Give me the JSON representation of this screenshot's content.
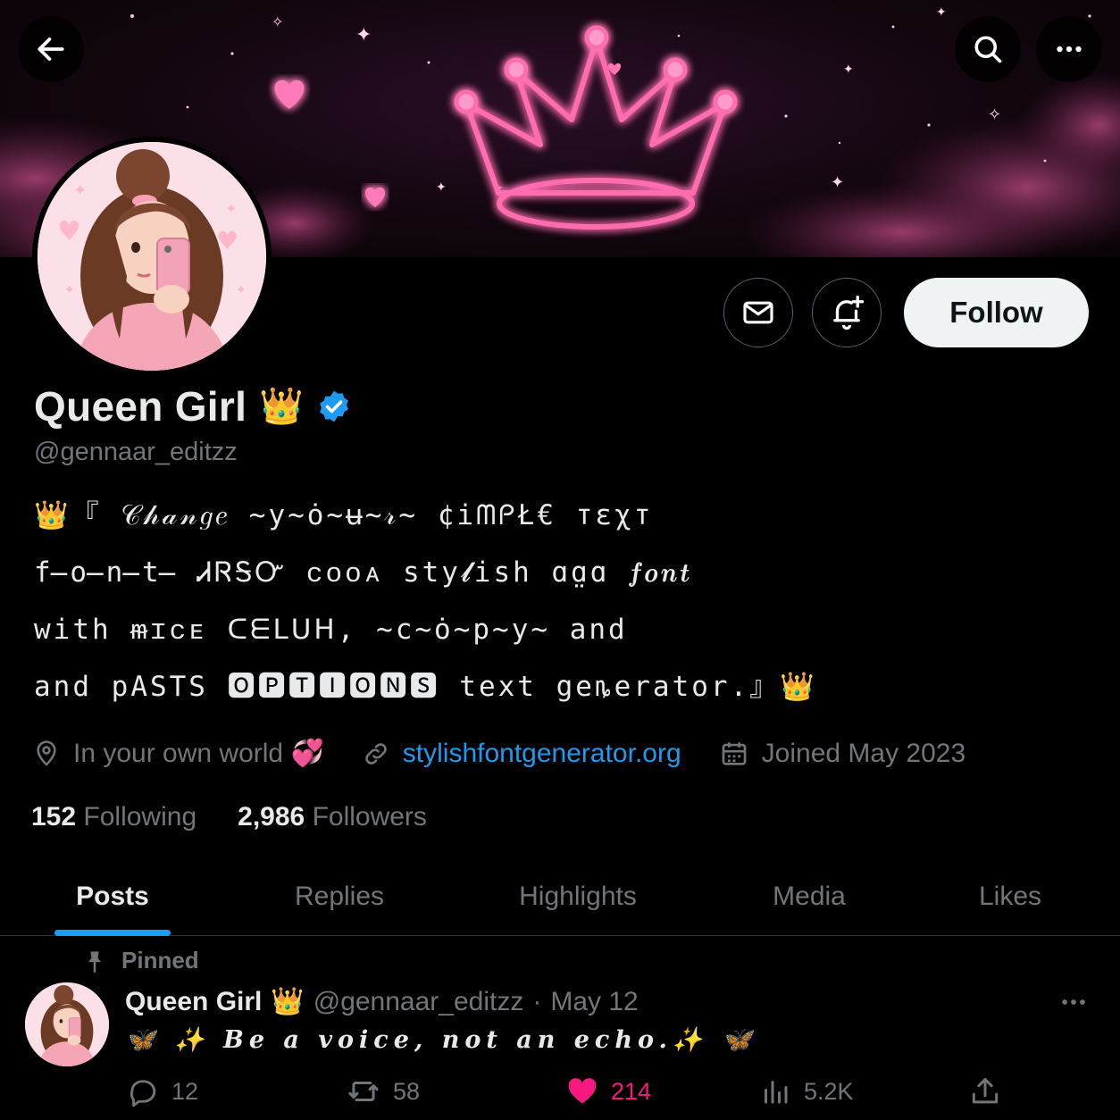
{
  "header": {
    "back_icon": "arrow-left-icon",
    "search_icon": "search-icon",
    "more_icon": "more-horizontal-icon"
  },
  "profile": {
    "display_name": "Queen Girl",
    "name_emoji": "👑",
    "verified": true,
    "handle": "@gennaar_editzz",
    "bio_lines": [
      "👑『 𝒞𝒽𝒶𝓃𝑔𝑒 ~y~ȯ~ʉ~𝓇~ ¢iᗰᑭŁ€ тεχт",
      "f̶o̶n̶t̶ ᏗᏒᎦᏅ ᴄᴏᴏᴀ sty𝓵ish ɑɑ̤ɑ 𝒇𝒐𝒏𝒕",
      "with ᵯɪᴄᴇ ᑕᗴᒪᑌᕼ, ~c~ȯ~p~y~ and",
      "and pASTS 🅾🅿🆃🅸🅾🅽🆂 text geȵerator.』👑"
    ],
    "location": "In your own world 💞",
    "website": "stylishfontgenerator.org",
    "joined": "Joined May 2023",
    "following_count": "152",
    "following_label": "Following",
    "followers_count": "2,986",
    "followers_label": "Followers",
    "follow_button": "Follow"
  },
  "tabs": [
    {
      "label": "Posts",
      "active": true
    },
    {
      "label": "Replies",
      "active": false
    },
    {
      "label": "Highlights",
      "active": false
    },
    {
      "label": "Media",
      "active": false
    },
    {
      "label": "Likes",
      "active": false
    }
  ],
  "pinned_post": {
    "pinned_label": "Pinned",
    "author_name": "Queen Girl",
    "author_emoji": "👑",
    "handle": "@gennaar_editzz",
    "separator": "·",
    "date": "May 12",
    "text": "🦋 ✨ Be a voice, not an echo.✨ 🦋",
    "replies": "12",
    "reposts": "58",
    "likes": "214",
    "views": "5.2K"
  },
  "colors": {
    "accent": "#1d9bf0",
    "like": "#f91880",
    "neon_pink": "#ff5fa8",
    "muted": "#71767b"
  }
}
